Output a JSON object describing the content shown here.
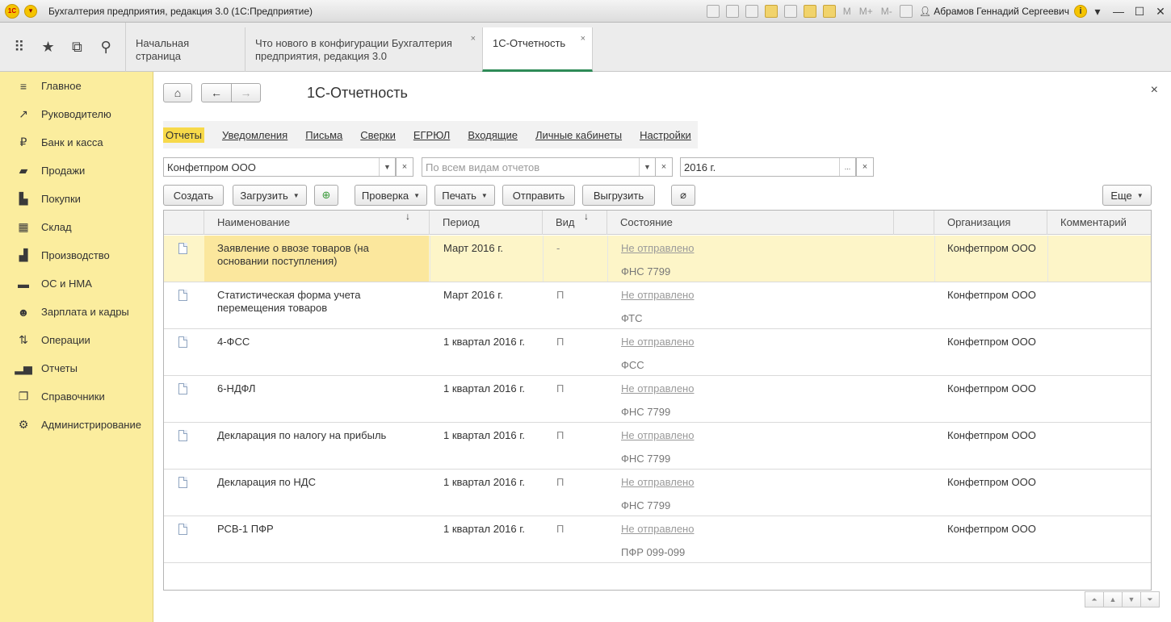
{
  "window": {
    "logo": "1С",
    "title": "Бухгалтерия предприятия, редакция 3.0  (1С:Предприятие)",
    "toolbar_memory": [
      "M",
      "M+",
      "M-"
    ],
    "user": "Абрамов Геннадий Сергеевич",
    "info": "i"
  },
  "tabs": [
    {
      "label": "Начальная страница"
    },
    {
      "label": "Что нового в конфигурации Бухгалтерия предприятия, редакция 3.0"
    },
    {
      "label": "1С-Отчетность"
    }
  ],
  "sidebar": {
    "items": [
      {
        "label": "Главное",
        "icon": "menu-icon"
      },
      {
        "label": "Руководителю",
        "icon": "trend-icon"
      },
      {
        "label": "Банк и касса",
        "icon": "ruble-icon"
      },
      {
        "label": "Продажи",
        "icon": "bag-icon"
      },
      {
        "label": "Покупки",
        "icon": "cart-icon"
      },
      {
        "label": "Склад",
        "icon": "warehouse-icon"
      },
      {
        "label": "Производство",
        "icon": "factory-icon"
      },
      {
        "label": "ОС и НМА",
        "icon": "truck-icon"
      },
      {
        "label": "Зарплата и кадры",
        "icon": "people-icon"
      },
      {
        "label": "Операции",
        "icon": "operations-icon"
      },
      {
        "label": "Отчеты",
        "icon": "bar-chart-icon"
      },
      {
        "label": "Справочники",
        "icon": "book-icon"
      },
      {
        "label": "Администрирование",
        "icon": "gear-icon"
      }
    ]
  },
  "form": {
    "title": "1С-Отчетность",
    "close": "×",
    "nav_links": [
      "Отчеты",
      "Уведомления",
      "Письма",
      "Сверки",
      "ЕГРЮЛ",
      "Входящие",
      "Личные кабинеты",
      "Настройки"
    ],
    "filters": {
      "organization": "Конфетпром ООО",
      "report_type_placeholder": "По всем видам отчетов",
      "period": "2016 г.",
      "period_btn": "..."
    },
    "buttons": {
      "create": "Создать",
      "load": "Загрузить",
      "check": "Проверка",
      "print": "Печать",
      "send": "Отправить",
      "export": "Выгрузить",
      "more": "Еще"
    }
  },
  "table": {
    "columns": [
      "Наименование",
      "Период",
      "Вид",
      "Состояние",
      "Организация",
      "Комментарий"
    ],
    "rows": [
      {
        "name": "Заявление о ввозе товаров (на основании поступления)",
        "period": "Март 2016 г.",
        "vid": "-",
        "state": "Не отправлено",
        "dest": "ФНС 7799",
        "org": "Конфетпром ООО"
      },
      {
        "name": "Статистическая форма учета перемещения товаров",
        "period": "Март 2016 г.",
        "vid": "П",
        "state": "Не отправлено",
        "dest": "ФТС",
        "org": "Конфетпром ООО"
      },
      {
        "name": "4-ФСС",
        "period": "1 квартал 2016 г.",
        "vid": "П",
        "state": "Не отправлено",
        "dest": "ФСС",
        "org": "Конфетпром ООО"
      },
      {
        "name": "6-НДФЛ",
        "period": "1 квартал 2016 г.",
        "vid": "П",
        "state": "Не отправлено",
        "dest": "ФНС 7799",
        "org": "Конфетпром ООО"
      },
      {
        "name": "Декларация по налогу на прибыль",
        "period": "1 квартал 2016 г.",
        "vid": "П",
        "state": "Не отправлено",
        "dest": "ФНС 7799",
        "org": "Конфетпром ООО"
      },
      {
        "name": "Декларация по НДС",
        "period": "1 квартал 2016 г.",
        "vid": "П",
        "state": "Не отправлено",
        "dest": "ФНС 7799",
        "org": "Конфетпром ООО"
      },
      {
        "name": "РСВ-1 ПФР",
        "period": "1 квартал 2016 г.",
        "vid": "П",
        "state": "Не отправлено",
        "dest": "ПФР 099-099",
        "org": "Конфетпром ООО"
      }
    ]
  }
}
